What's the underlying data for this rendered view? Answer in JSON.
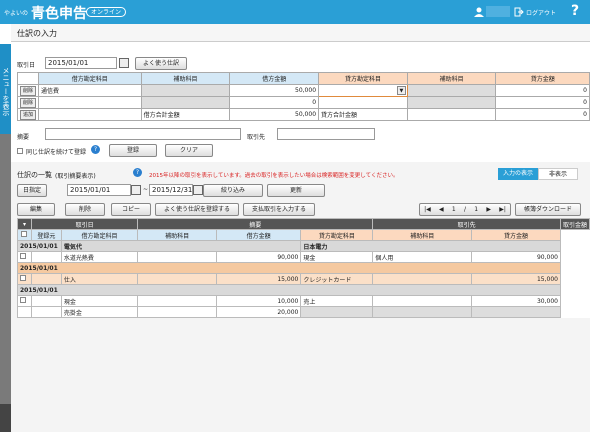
{
  "app": {
    "brand_small": "やよいの",
    "brand_big": "青色申告",
    "online_badge": "オンライン",
    "logout": "ログアウト"
  },
  "page": {
    "title": "仕訳の入力",
    "sidebar_label": "メニューを表示"
  },
  "entry": {
    "date_label": "取引日",
    "date_value": "2015/01/01",
    "favorite_button": "よく使う仕訳",
    "headers": [
      "借方勘定科目",
      "補助科目",
      "借方金額",
      "貸方勘定科目",
      "補助科目",
      "貸方金額"
    ],
    "rows": [
      {
        "action": "削除",
        "debit_account": "通信費",
        "debit_amount": "50,000",
        "credit_amount": "0"
      },
      {
        "action": "削除",
        "debit_account": "",
        "debit_amount": "0",
        "credit_amount": "0"
      },
      {
        "action": "追加",
        "debit_total_label": "借方合計金額",
        "debit_total": "50,000",
        "credit_total_label": "貸方合計金額",
        "credit_total": "0"
      }
    ],
    "memo_label": "摘要",
    "partner_label": "取引先",
    "keep_checkbox_label": "同じ仕訳を続けて登録",
    "register_button": "登録",
    "clear_button": "クリア"
  },
  "list": {
    "title": "仕訳の一覧",
    "subtitle": "(取引摘要表示)",
    "notice": "2015年以降の取引を表示しています。過去の取引を表示したい場合は検索範囲を変更してください。",
    "view_tab_input": "入力の表示",
    "view_tab_hide": "非表示",
    "date_mode": "日指定",
    "date_from": "2015/01/01",
    "date_to": "2015/12/31",
    "filter_button": "絞り込み",
    "refresh_button": "更新",
    "toolbar": {
      "edit": "編集",
      "delete": "削除",
      "copy": "コピー",
      "favorite": "よく使う仕訳を登録する",
      "payment": "支払取引を入力する",
      "download": "帳簿ダウンロード"
    },
    "page_current": "1",
    "page_sep": "/",
    "page_total": "1",
    "head1": {
      "date": "取引日",
      "memo": "摘要",
      "partner": "取引先",
      "amount": "取引金額"
    },
    "head2": {
      "registered": "登録元",
      "debit_acc": "借方勘定科目",
      "debit_sub": "補助科目",
      "debit_amt": "借方金額",
      "credit_acc": "貸方勘定科目",
      "credit_sub": "補助科目",
      "credit_amt": "貸方金額"
    },
    "groups": [
      {
        "date": "2015/01/01",
        "summary": [
          "電気代",
          "日本電力"
        ],
        "lines": [
          [
            "水道光熱費",
            "",
            "90,000",
            "現金",
            "個人用",
            "90,000"
          ]
        ]
      },
      {
        "date": "2015/01/01",
        "highlight": true,
        "lines": [
          [
            "仕入",
            "",
            "15,000",
            "クレジットカード",
            "",
            "15,000"
          ]
        ]
      },
      {
        "date": "2015/01/01",
        "lines": [
          [
            "現金",
            "",
            "10,000",
            "売上",
            "",
            "30,000"
          ],
          [
            "売掛金",
            "",
            "20,000",
            "",
            "",
            ""
          ]
        ]
      }
    ]
  }
}
